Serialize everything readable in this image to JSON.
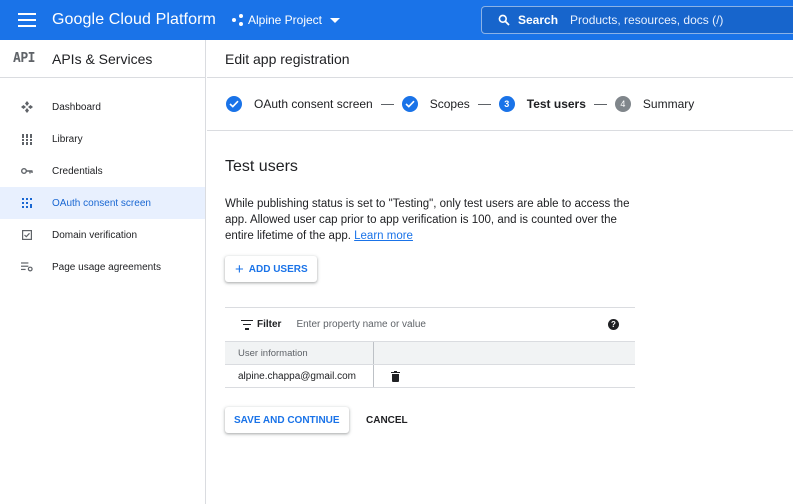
{
  "topbar": {
    "brand": "Google Cloud Platform",
    "project": "Alpine Project",
    "search_label": "Search",
    "search_placeholder": "Products, resources, docs (/)"
  },
  "sidebar": {
    "logo": "API",
    "title": "APIs & Services",
    "items": [
      {
        "label": "Dashboard",
        "icon": "dashboard-icon"
      },
      {
        "label": "Library",
        "icon": "library-icon"
      },
      {
        "label": "Credentials",
        "icon": "key-icon"
      },
      {
        "label": "OAuth consent screen",
        "icon": "consent-icon",
        "active": true
      },
      {
        "label": "Domain verification",
        "icon": "checkbox-icon"
      },
      {
        "label": "Page usage agreements",
        "icon": "settings-list-icon"
      }
    ]
  },
  "main": {
    "page_title": "Edit app registration",
    "steps": [
      {
        "label": "OAuth consent screen",
        "status": "done"
      },
      {
        "label": "Scopes",
        "status": "done"
      },
      {
        "label": "Test users",
        "number": "3",
        "status": "current"
      },
      {
        "label": "Summary",
        "number": "4",
        "status": "todo"
      }
    ],
    "section_title": "Test users",
    "description": "While publishing status is set to \"Testing\", only test users are able to access the app. Allowed user cap prior to app verification is 100, and is counted over the entire lifetime of the app.",
    "learn_more": "Learn more",
    "add_users_label": "ADD USERS",
    "filter": {
      "label": "Filter",
      "placeholder": "Enter property name or value"
    },
    "table": {
      "header": "User information",
      "rows": [
        {
          "user": "alpine.chappa@gmail.com"
        }
      ]
    },
    "save_label": "SAVE AND CONTINUE",
    "cancel_label": "CANCEL"
  }
}
